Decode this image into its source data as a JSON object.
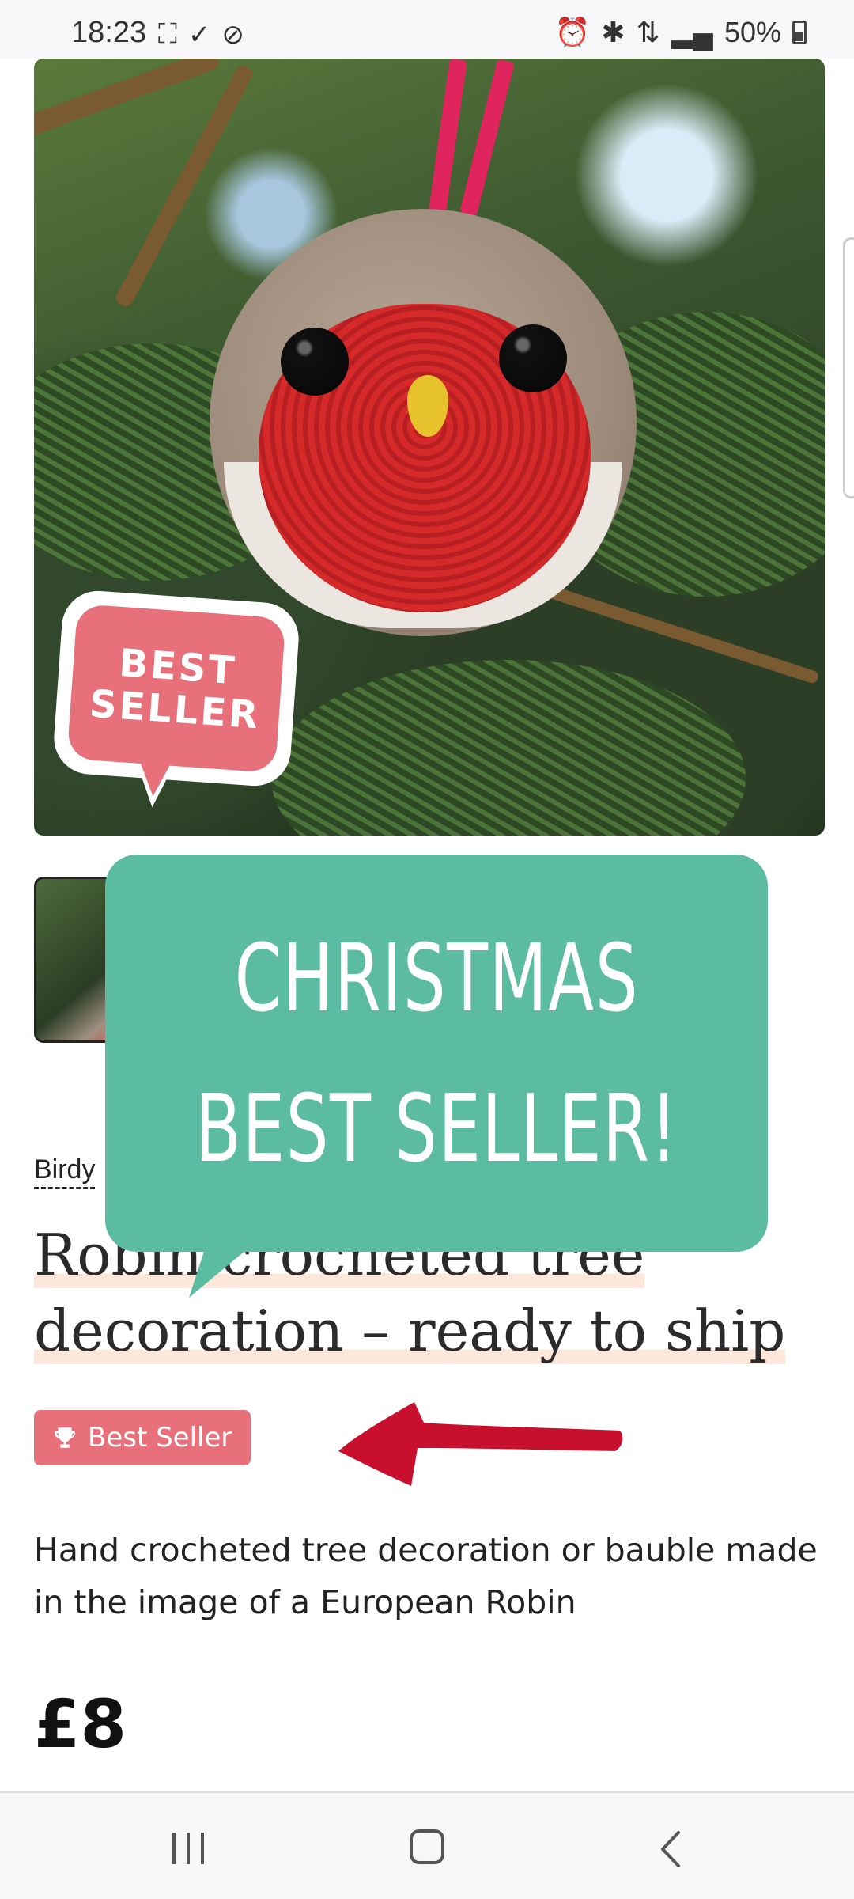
{
  "status_bar": {
    "time": "18:23",
    "battery": "50%",
    "left_icons": [
      "screenshot-icon",
      "download-done-icon",
      "data-saver-icon"
    ],
    "right_icons": [
      "alarm-icon",
      "bluetooth-icon",
      "data-transfer-icon",
      "signal-icon",
      "battery-icon"
    ]
  },
  "product": {
    "image_badge": "BEST\nSELLER",
    "shop_name": "Birdy",
    "title_line1": "Robin crocheted tree",
    "title_line2": "decoration – ready to ship",
    "tag": "Best Seller",
    "description": "Hand crocheted tree decoration or bauble made in the image of a European Robin",
    "price": "£8"
  },
  "overlay": {
    "line1": "CHRISTMAS",
    "line2": "BEST SELLER!"
  },
  "colors": {
    "promo_green": "#5bbca1",
    "badge_pink": "#e8707a",
    "arrow_red": "#c8102e"
  },
  "nav_bar": {
    "icons": [
      "recents-icon",
      "home-icon",
      "back-icon"
    ]
  }
}
